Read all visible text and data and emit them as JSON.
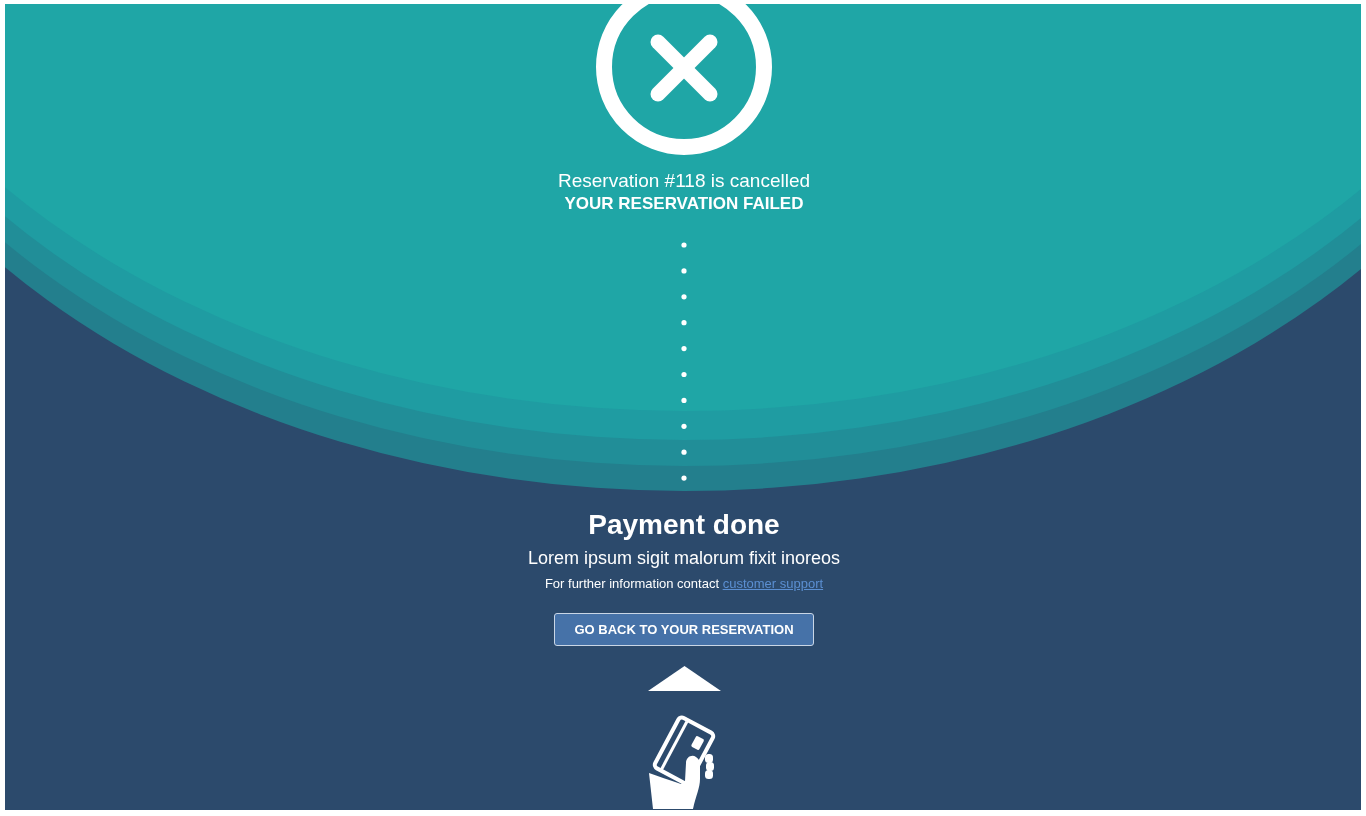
{
  "status": {
    "kind": "failed",
    "line": "Reservation #118 is cancelled",
    "headline": "YOUR RESERVATION FAILED"
  },
  "payment": {
    "title": "Payment done",
    "subtitle": "Lorem ipsum sigit malorum fixit inoreos",
    "contact": {
      "text": "For further information contact",
      "link": "customer support"
    }
  },
  "button": {
    "label": "GO BACK TO YOUR RESERVATION"
  }
}
